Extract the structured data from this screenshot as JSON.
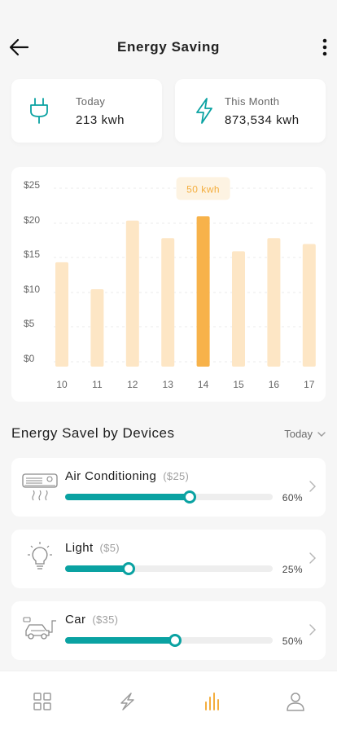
{
  "header": {
    "title": "Energy Saving",
    "back_icon": "arrow-left-icon",
    "menu_icon": "more-vertical-icon"
  },
  "stats": {
    "today": {
      "label": "Today",
      "value": "213 kwh",
      "icon": "plug-icon"
    },
    "month": {
      "label": "This Month",
      "value": "873,534 kwh",
      "icon": "lightning-icon"
    }
  },
  "chart_data": {
    "type": "bar",
    "categories": [
      "10",
      "11",
      "12",
      "13",
      "14",
      "15",
      "16",
      "17"
    ],
    "values": [
      14.3,
      10.6,
      20.0,
      17.6,
      20.6,
      15.8,
      17.6,
      16.8
    ],
    "highlight_index": 4,
    "highlight_label": "50 kwh",
    "yticks": [
      "$25",
      "$20",
      "$15",
      "$10",
      "$5",
      "$0"
    ],
    "ylim": [
      0,
      25
    ],
    "grid": true,
    "colors": {
      "bar": "#fde6c5",
      "highlight": "#f7b24a",
      "label_text": "#f4ae3f",
      "label_bg": "#fdf3e2"
    }
  },
  "devices_section": {
    "title": "Energy Savel by Devices",
    "period": "Today",
    "items": [
      {
        "name": "Air Conditioning",
        "cost": "($25)",
        "percent_label": "60%",
        "level": 0.6,
        "icon": "air-conditioner-icon"
      },
      {
        "name": "Light",
        "cost": "($5)",
        "percent_label": "25%",
        "level": 0.305,
        "icon": "lightbulb-icon"
      },
      {
        "name": "Car",
        "cost": "($35)",
        "percent_label": "50%",
        "level": 0.53,
        "icon": "car-icon"
      }
    ]
  },
  "tabbar": {
    "tabs": [
      {
        "icon": "grid-icon",
        "active": false
      },
      {
        "icon": "lightning-icon",
        "active": false
      },
      {
        "icon": "bar-chart-icon",
        "active": true
      },
      {
        "icon": "user-icon",
        "active": false
      }
    ]
  },
  "colors": {
    "accent": "#0aa2a2",
    "highlight": "#f7b24a"
  }
}
